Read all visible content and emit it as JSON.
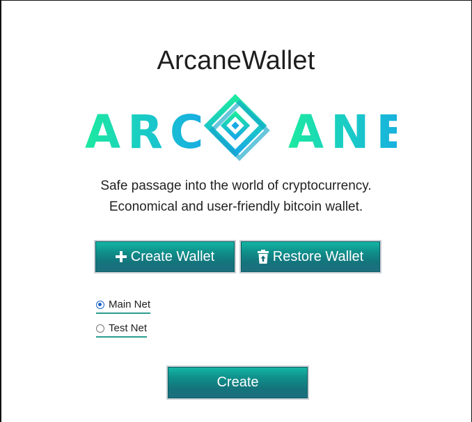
{
  "app": {
    "title": "ArcaneWallet",
    "logo_text_left": "ARC",
    "logo_text_right": "ANE"
  },
  "tagline": {
    "line1": "Safe passage into the world of cryptocurrency.",
    "line2": "Economical and user-friendly bitcoin wallet."
  },
  "actions": {
    "create_wallet_label": "Create Wallet",
    "create_wallet_icon": "plus-icon",
    "restore_wallet_label": "Restore Wallet",
    "restore_wallet_icon": "trash-restore-icon"
  },
  "network": {
    "options": [
      {
        "label": "Main Net",
        "selected": true
      },
      {
        "label": "Test Net",
        "selected": false
      }
    ]
  },
  "submit": {
    "label": "Create"
  },
  "colors": {
    "accent_green": "#1de9a0",
    "accent_blue": "#18a9e6",
    "button_teal": "#14737c",
    "radio_selected": "#1a63c7",
    "underline": "#2a9d8f"
  }
}
